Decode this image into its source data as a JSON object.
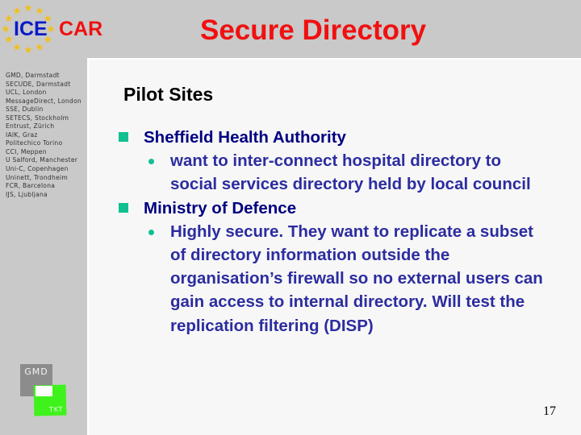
{
  "logo": {
    "left_word": "ICE",
    "right_word": "CAR",
    "left_color": "#0a1ac8",
    "right_color": "#f01010",
    "star_color": "#f0c020"
  },
  "sidebar": {
    "partners": [
      "GMD, Darmstadt",
      "SECUDE, Darmstadt",
      "UCL, London",
      "MessageDirect, London",
      "SSE, Dublin",
      "SETECS, Stockholm",
      "Entrust, Zürich",
      "IAIK, Graz",
      "Politechico Torino",
      "CCI, Meppen",
      "U Salford, Manchester",
      "Uni-C, Copenhagen",
      "Uninett, Trondheim",
      "FCR, Barcelona",
      "IJS, Ljubljana"
    ],
    "bottom_logo": {
      "top_label": "GMD",
      "bottom_label": "TKT"
    }
  },
  "slide": {
    "title": "Secure Directory",
    "heading": "Pilot Sites",
    "items": [
      {
        "label": "Sheffield Health Authority",
        "subitems": [
          "want to inter-connect hospital directory to social services directory held by local council"
        ]
      },
      {
        "label": "Ministry of Defence",
        "subitems": [
          "Highly secure. They want to replicate a subset of directory information outside the organisation’s firewall so no external users can gain access to internal directory. Will test the replication filtering (DISP)"
        ]
      }
    ],
    "page_number": "17"
  },
  "colors": {
    "title": "#f01010",
    "level1_text": "#000080",
    "level2_text": "#2c2ca0",
    "bullet": "#10c090",
    "sidebar_bg": "#c9c9c9",
    "panel_bg": "#f7f7f7"
  }
}
